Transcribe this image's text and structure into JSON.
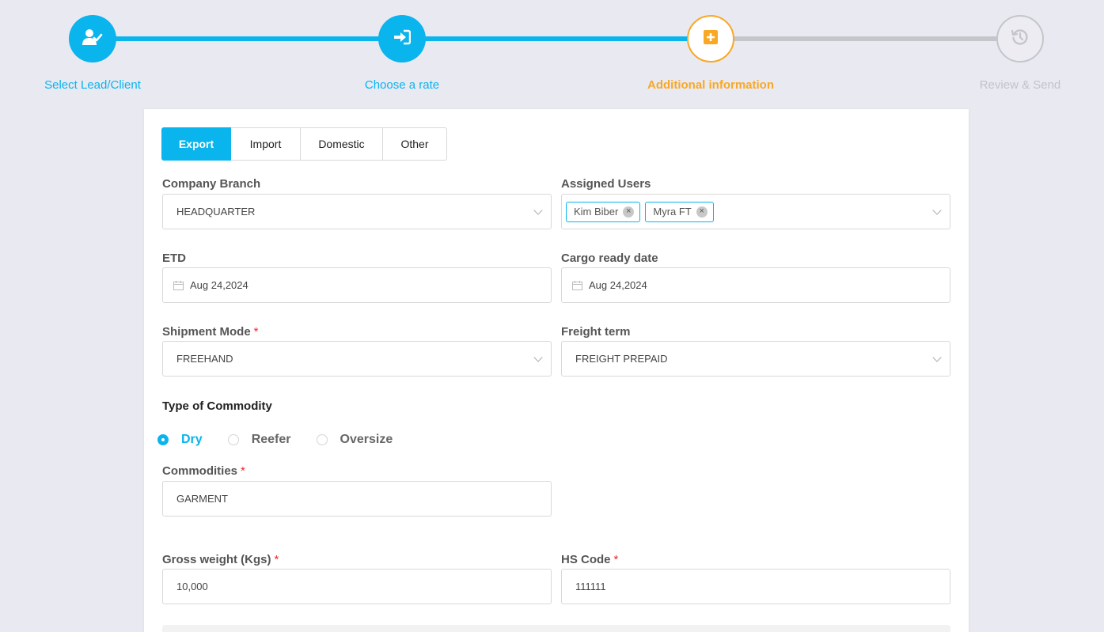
{
  "stepper": {
    "steps": [
      {
        "label": "Select Lead/Client",
        "state": "done",
        "icon": "user-check-icon"
      },
      {
        "label": "Choose a rate",
        "state": "done",
        "icon": "sign-in-icon"
      },
      {
        "label": "Additional information",
        "state": "active",
        "icon": "plus-square-icon"
      },
      {
        "label": "Review & Send",
        "state": "todo",
        "icon": "history-icon"
      }
    ]
  },
  "colors": {
    "primary": "#0ab4ec",
    "active": "#f9a825",
    "inactive": "#c5c5cc",
    "required": "#f5222d"
  },
  "tabs": [
    {
      "label": "Export",
      "active": true
    },
    {
      "label": "Import",
      "active": false
    },
    {
      "label": "Domestic",
      "active": false
    },
    {
      "label": "Other",
      "active": false
    }
  ],
  "form": {
    "company_branch": {
      "label": "Company Branch",
      "value": "HEADQUARTER"
    },
    "assigned_users": {
      "label": "Assigned Users",
      "tags": [
        "Kim Biber",
        "Myra FT"
      ]
    },
    "etd": {
      "label": "ETD",
      "value": "Aug 24,2024"
    },
    "cargo_ready_date": {
      "label": "Cargo ready date",
      "value": "Aug 24,2024"
    },
    "shipment_mode": {
      "label": "Shipment Mode",
      "required_mark": "*",
      "value": "FREEHAND"
    },
    "freight_term": {
      "label": "Freight term",
      "value": "FREIGHT PREPAID"
    },
    "commodity_type": {
      "title": "Type of Commodity",
      "options": [
        {
          "label": "Dry",
          "checked": true
        },
        {
          "label": "Reefer",
          "checked": false
        },
        {
          "label": "Oversize",
          "checked": false
        }
      ]
    },
    "commodities": {
      "label": "Commodities",
      "required_mark": "*",
      "value": "GARMENT"
    },
    "gross_weight": {
      "label": "Gross weight (Kgs)",
      "required_mark": "*",
      "value": "10,000"
    },
    "hs_code": {
      "label": "HS Code",
      "required_mark": "*",
      "value": "111111"
    }
  }
}
